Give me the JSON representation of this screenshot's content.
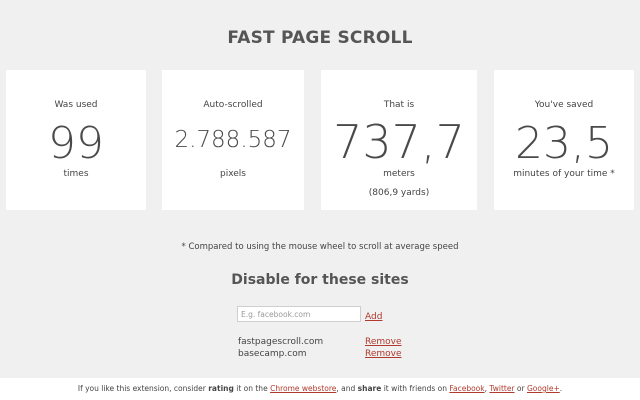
{
  "title": "FAST PAGE SCROLL",
  "stats": [
    {
      "label": "Was used",
      "value": "99",
      "unit": "times"
    },
    {
      "label": "Auto-scrolled",
      "value": "2.788.587",
      "unit": "pixels"
    },
    {
      "label": "That is",
      "value": "737,7",
      "unit": "meters",
      "extra": "(806,9 yards)"
    },
    {
      "label": "You've saved",
      "value": "23,5",
      "unit": "minutes of your time *"
    }
  ],
  "footnote": "* Compared to using the mouse wheel to scroll at average speed",
  "disable_section": {
    "title": "Disable for these sites",
    "input_placeholder": "E.g. facebook.com",
    "input_value": "",
    "add_label": "Add",
    "sites": [
      {
        "name": "fastpagescroll.com",
        "remove_label": "Remove"
      },
      {
        "name": "basecamp.com",
        "remove_label": "Remove"
      }
    ]
  },
  "footer": {
    "t1": "If you like this extension, consider",
    "t2": "rating",
    "t3": "it on the",
    "link1": "Chrome webstore",
    "t4": ", and",
    "t5": "share",
    "t6": "it with friends on",
    "link2": "Facebook",
    "t7": ",",
    "link3": "Twitter",
    "t8": "or",
    "link4": "Google+",
    "t9": "."
  },
  "colors": {
    "background": "#f0f0f0",
    "card": "#ffffff",
    "text": "#555555",
    "link": "#b03a2e"
  }
}
